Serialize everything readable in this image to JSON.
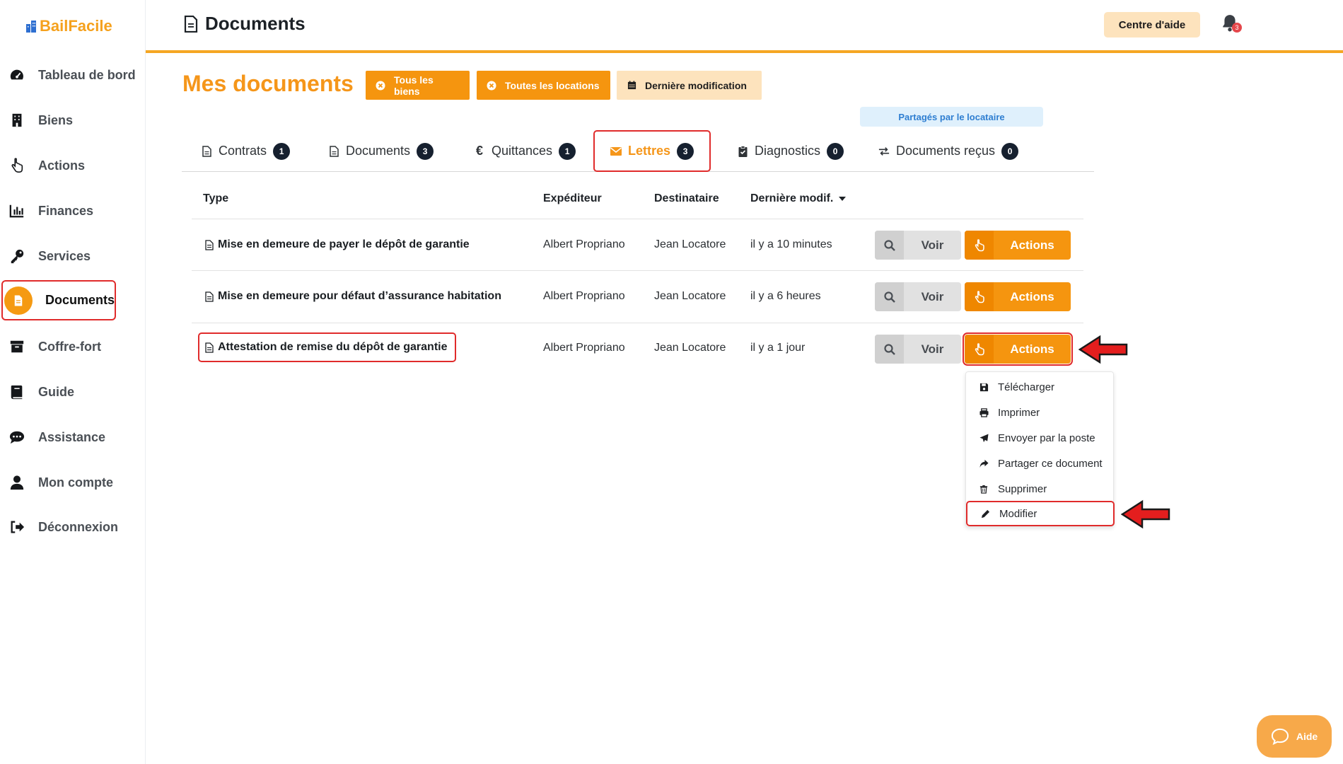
{
  "brand": {
    "name": "BailFacile",
    "color": "#f5a11d"
  },
  "sidebar": {
    "items": [
      {
        "label": "Tableau de bord",
        "icon": "gauge-icon"
      },
      {
        "label": "Biens",
        "icon": "building-icon"
      },
      {
        "label": "Actions",
        "icon": "pointer-hand-icon"
      },
      {
        "label": "Finances",
        "icon": "bar-chart-icon"
      },
      {
        "label": "Services",
        "icon": "key-icon"
      },
      {
        "label": "Documents",
        "icon": "document-icon",
        "active": true
      },
      {
        "label": "Coffre-fort",
        "icon": "archive-box-icon"
      },
      {
        "label": "Guide",
        "icon": "book-icon"
      },
      {
        "label": "Assistance",
        "icon": "chat-bubble-icon"
      },
      {
        "label": "Mon compte",
        "icon": "user-icon"
      },
      {
        "label": "Déconnexion",
        "icon": "logout-icon"
      }
    ]
  },
  "topbar": {
    "title": "Documents",
    "help_label": "Centre d'aide",
    "notifications_count": "3"
  },
  "header": {
    "title": "Mes documents",
    "filters": [
      {
        "label": "Tous les biens",
        "icon": "clear-circle-icon"
      },
      {
        "label": "Toutes les locations",
        "icon": "clear-circle-icon"
      },
      {
        "label": "Dernière modification",
        "icon": "calendar-icon"
      }
    ],
    "shared_label": "Partagés par le locataire"
  },
  "tabs": [
    {
      "label": "Contrats",
      "count": "1",
      "icon": "file-icon"
    },
    {
      "label": "Documents",
      "count": "3",
      "icon": "file-icon"
    },
    {
      "label": "Quittances",
      "count": "1",
      "icon": "euro-icon"
    },
    {
      "label": "Lettres",
      "count": "3",
      "icon": "envelope-icon",
      "active": true
    },
    {
      "label": "Diagnostics",
      "count": "0",
      "icon": "clipboard-check-icon"
    },
    {
      "label": "Documents reçus",
      "count": "0",
      "icon": "exchange-icon"
    }
  ],
  "table": {
    "columns": [
      "Type",
      "Expéditeur",
      "Destinataire",
      "Dernière modif."
    ],
    "rows": [
      {
        "type": "Mise en demeure de payer le dépôt de garantie",
        "sender": "Albert Propriano",
        "recipient": "Jean Locatore",
        "modified": "il y a 10 minutes"
      },
      {
        "type": "Mise en demeure pour défaut d’assurance habitation",
        "sender": "Albert Propriano",
        "recipient": "Jean Locatore",
        "modified": "il y a 6 heures"
      },
      {
        "type": "Attestation de remise du dépôt de garantie",
        "sender": "Albert Propriano",
        "recipient": "Jean Locatore",
        "modified": "il y a 1 jour"
      }
    ],
    "view_label": "Voir",
    "actions_label": "Actions"
  },
  "actions_menu": {
    "items": [
      {
        "label": "Télécharger",
        "icon": "save-icon"
      },
      {
        "label": "Imprimer",
        "icon": "printer-icon"
      },
      {
        "label": "Envoyer par la poste",
        "icon": "paper-plane-icon"
      },
      {
        "label": "Partager ce document",
        "icon": "share-icon"
      },
      {
        "label": "Supprimer",
        "icon": "trash-icon"
      },
      {
        "label": "Modifier",
        "icon": "pencil-icon"
      }
    ]
  },
  "chat": {
    "label": "Aide"
  },
  "colors": {
    "accent": "#f5950f",
    "highlight": "#e02b2b",
    "badge": "#16202f"
  }
}
